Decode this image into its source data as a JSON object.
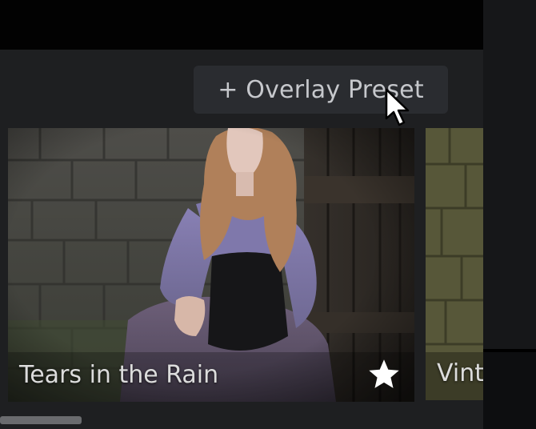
{
  "toolbar": {
    "add_overlay_preset_label": "+ Overlay Preset"
  },
  "presets": [
    {
      "title": "Tears in the Rain",
      "favorite_icon": "star-icon",
      "favorited": true
    },
    {
      "title": "Vint"
    }
  ],
  "colors": {
    "panel_bg": "#1e1f21",
    "button_bg": "#2a2c30",
    "text": "#dcdcdc"
  }
}
